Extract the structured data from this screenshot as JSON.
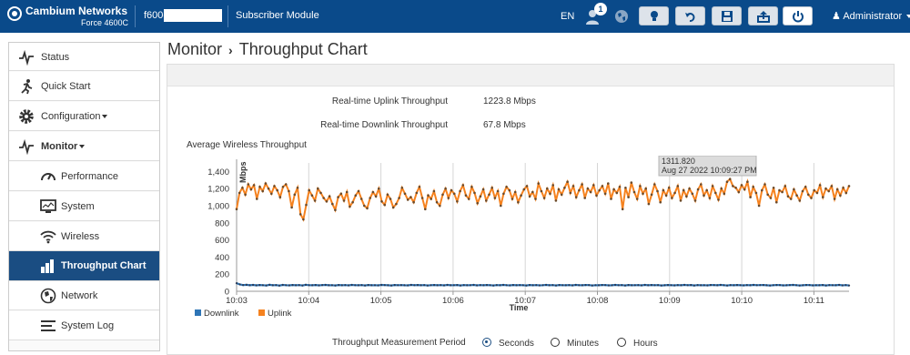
{
  "header": {
    "brand": "Cambium Networks",
    "model": "Force 4600C",
    "device_name": "f600-",
    "module": "Subscriber Module",
    "language": "EN",
    "notification_count": "1",
    "user": "Administrator",
    "colors": {
      "bar": "#0a4a8a",
      "accent": "#f5821f"
    }
  },
  "sidebar": {
    "items": [
      {
        "label": "Status",
        "icon": "pulse-icon"
      },
      {
        "label": "Quick Start",
        "icon": "runner-icon"
      },
      {
        "label": "Configuration",
        "icon": "gear-icon"
      },
      {
        "label": "Monitor",
        "icon": "pulse-icon"
      },
      {
        "label": "Performance",
        "icon": "gauge-icon"
      },
      {
        "label": "System",
        "icon": "monitor-icon"
      },
      {
        "label": "Wireless",
        "icon": "wifi-icon"
      },
      {
        "label": "Throughput Chart",
        "icon": "bar-chart-icon"
      },
      {
        "label": "Network",
        "icon": "globe-icon"
      },
      {
        "label": "System Log",
        "icon": "list-icon"
      }
    ]
  },
  "page": {
    "breadcrumb_parent": "Monitor",
    "breadcrumb_current": "Throughput Chart",
    "uplink_label": "Real-time Uplink Throughput",
    "uplink_value": "1223.8 Mbps",
    "downlink_label": "Real-time Downlink Throughput",
    "downlink_value": "67.8 Mbps",
    "chart_title": "Average Wireless Throughput",
    "period_label": "Throughput Measurement Period",
    "period_options": [
      "Seconds",
      "Minutes",
      "Hours"
    ],
    "period_selected": "Seconds"
  },
  "chart_data": {
    "type": "line",
    "title": "Average Wireless Throughput",
    "xlabel": "Time",
    "ylabel": "Mbps",
    "ylim": [
      0,
      1500
    ],
    "yticks": [
      0,
      200,
      400,
      600,
      800,
      1000,
      1200,
      1400
    ],
    "ytick_labels": [
      "0",
      "200",
      "400",
      "600",
      "800",
      "1,000",
      "1,200",
      "1,400"
    ],
    "xticks": [
      "10:03",
      "10:04",
      "10:05",
      "10:06",
      "10:07",
      "10:08",
      "10:09",
      "10:10",
      "10:11"
    ],
    "grid": "vertical",
    "legend_position": "bottom-left",
    "tooltip": {
      "value": "1311.820",
      "time": "Aug 27 2022 10:09:27 PM"
    },
    "series": [
      {
        "name": "Downlink",
        "color": "#2e75b6",
        "values": [
          95,
          80,
          72,
          76,
          70,
          74,
          69,
          73,
          71,
          68,
          75,
          70,
          72,
          67,
          74,
          71,
          69,
          73,
          70,
          72,
          68,
          75,
          71,
          70,
          73,
          69,
          72,
          74,
          70,
          71,
          68,
          73,
          70,
          72,
          69,
          74,
          71,
          70,
          72,
          68,
          73,
          70,
          71,
          69,
          74,
          72,
          70,
          68,
          73,
          71,
          72,
          70,
          69,
          74,
          71,
          73,
          70,
          72,
          68,
          71,
          73,
          70,
          72,
          69,
          74,
          70,
          71,
          73,
          68,
          72,
          70,
          71,
          74,
          69,
          72,
          70,
          73,
          71,
          68,
          72,
          70,
          74,
          71,
          69,
          73,
          70,
          72,
          71,
          68,
          73,
          70,
          72,
          69,
          71,
          74,
          70,
          72,
          68,
          73,
          71,
          70,
          72,
          69,
          74,
          71,
          70,
          73,
          72,
          68,
          71,
          70,
          73,
          72,
          69,
          70,
          74,
          71,
          72,
          68,
          73,
          70,
          71,
          72,
          69,
          74,
          70,
          73,
          71,
          72,
          68,
          70,
          73,
          71,
          69,
          72,
          70,
          74,
          71,
          73,
          68,
          72,
          70,
          71,
          69,
          73,
          72,
          70,
          74,
          71,
          68,
          72,
          70,
          73,
          71,
          69,
          72,
          70,
          74,
          71,
          72,
          73,
          70,
          68,
          71,
          73,
          72,
          69,
          70,
          72,
          74,
          71,
          68,
          70,
          73,
          72,
          69,
          71,
          70,
          73,
          68,
          72,
          71,
          70,
          74,
          69,
          72,
          68
        ]
      },
      {
        "name": "Uplink",
        "color": "#f5821f",
        "values": [
          960,
          1150,
          1210,
          1130,
          1250,
          1190,
          1240,
          1080,
          1220,
          1170,
          1260,
          1200,
          1140,
          1230,
          1180,
          1100,
          1220,
          1250,
          1170,
          980,
          1130,
          1210,
          900,
          840,
          1010,
          1180,
          1120,
          1060,
          1200,
          1150,
          1090,
          1050,
          1110,
          1020,
          950,
          1100,
          1140,
          1060,
          1160,
          990,
          1040,
          1120,
          1170,
          1080,
          1000,
          970,
          1090,
          1160,
          1110,
          1200,
          1050,
          1010,
          1130,
          1080,
          980,
          1020,
          1090,
          1210,
          1140,
          1070,
          1100,
          1040,
          1150,
          1220,
          1090,
          960,
          1120,
          1080,
          1170,
          1040,
          1000,
          1130,
          1200,
          1090,
          1180,
          1140,
          1050,
          1170,
          1240,
          1120,
          1080,
          1220,
          1150,
          1030,
          1110,
          1190,
          1060,
          1130,
          1210,
          1090,
          1170,
          1000,
          1140,
          1220,
          1180,
          1080,
          1160,
          1040,
          1120,
          1190,
          1230,
          1110,
          1160,
          1080,
          1260,
          1170,
          1090,
          1200,
          1140,
          1240,
          1060,
          1190,
          1130,
          1210,
          1280,
          1150,
          1230,
          1100,
          1180,
          1250,
          1090,
          1200,
          1160,
          1240,
          1120,
          1180,
          1230,
          1140,
          1260,
          1080,
          1190,
          1150,
          1220,
          960,
          1210,
          1100,
          1270,
          1160,
          1080,
          1230,
          1140,
          1200,
          1020,
          1130,
          1250,
          1170,
          1040,
          1180,
          1120,
          1210,
          1090,
          1150,
          1230,
          1060,
          1180,
          1110,
          1200,
          1140,
          1060,
          1190,
          1250,
          1120,
          1180,
          1090,
          1230,
          1150,
          1070,
          1200,
          1140,
          1280,
          1311.82,
          1230,
          1210,
          1160,
          1240,
          1190,
          1280,
          1100,
          1220,
          1150,
          1000,
          1180,
          1250,
          1130,
          1090,
          1210,
          1040,
          1180,
          1160,
          1230,
          1110,
          1080,
          1190,
          1120,
          1060,
          1170,
          1220,
          1130,
          1090,
          1180,
          1150,
          1240,
          1100,
          1200,
          1170,
          1230,
          1080,
          1190,
          1120,
          1210,
          1150,
          1230
        ]
      }
    ]
  }
}
